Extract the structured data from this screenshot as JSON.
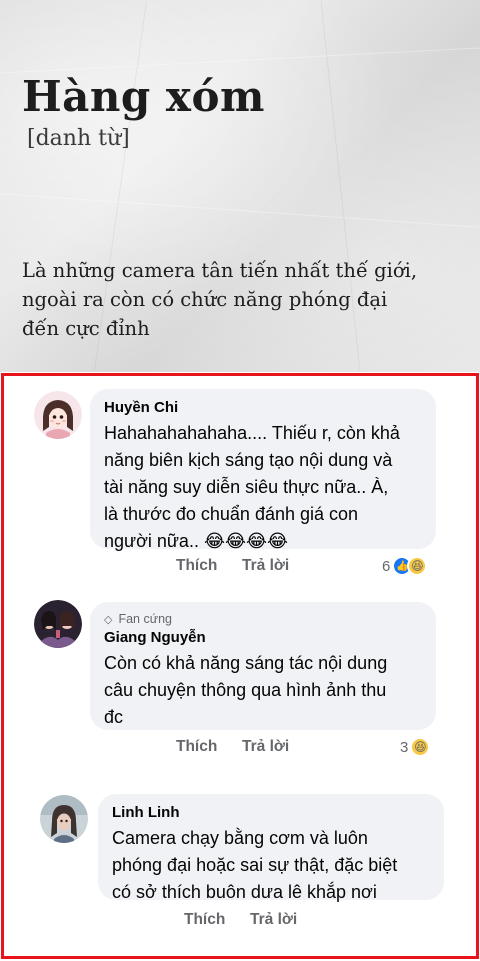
{
  "definition_card": {
    "word": "Hàng xóm",
    "part_of_speech": "[danh từ]",
    "definition_lines": [
      "Là những camera tân tiến nhất thế giới,",
      "ngoài ra còn có chức năng phóng đại",
      "đến cực đỉnh"
    ]
  },
  "comments": [
    {
      "author": "Huyền Chi",
      "badge": "",
      "text_lines": [
        "Hahahahahahaha....  Thiếu r,  còn khả",
        "năng biên kịch sáng tạo nội dung và",
        "tài năng suy diễn siêu thực nữa..  À,",
        "là thước đo chuẩn đánh giá con",
        "người nữa.. 😂😂😂😂"
      ],
      "like_label": "Thích",
      "reply_label": "Trả lời",
      "reaction_count": "6",
      "reactions": [
        "like-icon",
        "haha-icon"
      ]
    },
    {
      "author": "Giang Nguyễn",
      "badge": "Fan cứng",
      "text_lines": [
        "Còn có khả năng sáng tác nội dung",
        "câu chuyện thông qua hình ảnh thu",
        "đc"
      ],
      "like_label": "Thích",
      "reply_label": "Trả lời",
      "reaction_count": "3",
      "reactions": [
        "haha-icon"
      ]
    },
    {
      "author": "Linh Linh",
      "badge": "",
      "text_lines": [
        "Camera chạy bằng cơm và luôn",
        "phóng đại hoặc sai sự thật, đặc biệt",
        "có sở thích buôn dưa lê khắp nơi"
      ],
      "like_label": "Thích",
      "reply_label": "Trả lời",
      "reaction_count": "",
      "reactions": []
    }
  ],
  "colors": {
    "highlight_border": "#e8141c",
    "bubble_bg": "#f0f2f5",
    "meta_text": "#65676b",
    "like_blue": "#1877f2"
  }
}
